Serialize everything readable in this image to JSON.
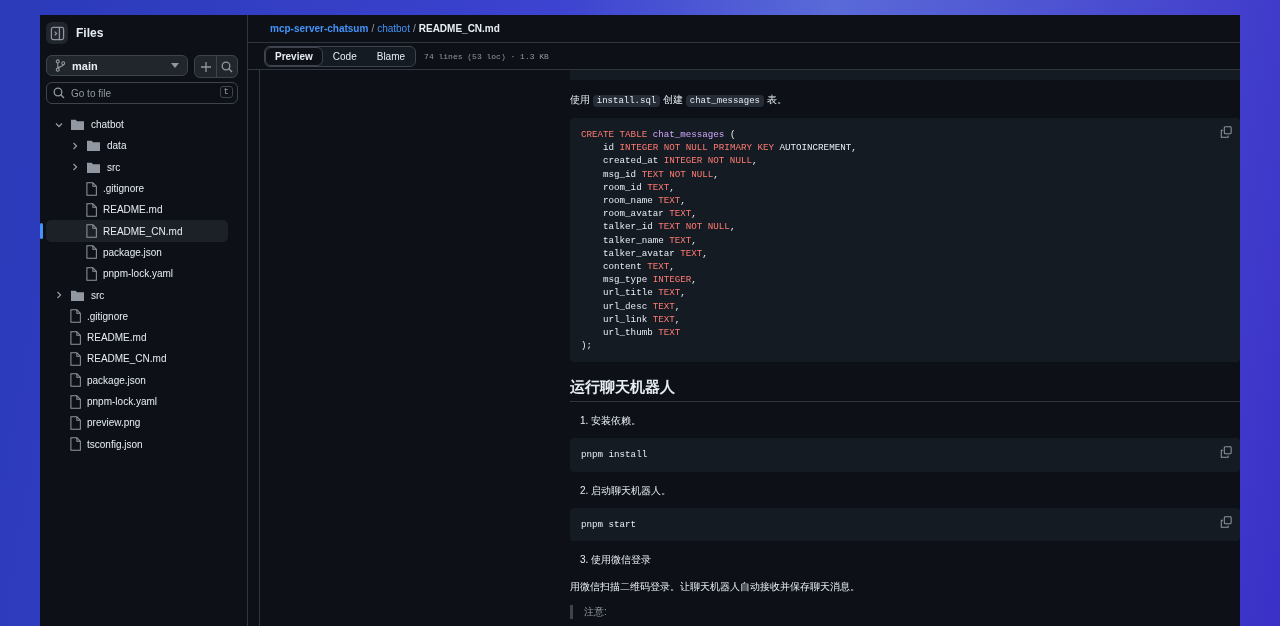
{
  "sidebar": {
    "title": "Files",
    "branch": "main",
    "search": {
      "placeholder": "Go to file",
      "shortcut": "t"
    },
    "tree": [
      {
        "name": "chatbot",
        "kind": "folder",
        "expanded": true,
        "selected": false,
        "children": [
          {
            "name": "data",
            "kind": "folder",
            "expanded": false,
            "selected": false
          },
          {
            "name": "src",
            "kind": "folder",
            "expanded": false,
            "selected": false
          },
          {
            "name": ".gitignore",
            "kind": "file",
            "selected": false
          },
          {
            "name": "README.md",
            "kind": "file",
            "selected": false
          },
          {
            "name": "README_CN.md",
            "kind": "file",
            "selected": true
          },
          {
            "name": "package.json",
            "kind": "file",
            "selected": false
          },
          {
            "name": "pnpm-lock.yaml",
            "kind": "file",
            "selected": false
          }
        ]
      },
      {
        "name": "src",
        "kind": "folder",
        "expanded": false,
        "selected": false
      },
      {
        "name": ".gitignore",
        "kind": "file",
        "selected": false
      },
      {
        "name": "README.md",
        "kind": "file",
        "selected": false
      },
      {
        "name": "README_CN.md",
        "kind": "file",
        "selected": false
      },
      {
        "name": "package.json",
        "kind": "file",
        "selected": false
      },
      {
        "name": "pnpm-lock.yaml",
        "kind": "file",
        "selected": false
      },
      {
        "name": "preview.png",
        "kind": "file",
        "selected": false
      },
      {
        "name": "tsconfig.json",
        "kind": "file",
        "selected": false
      }
    ]
  },
  "breadcrumb_separator": "/",
  "breadcrumb": [
    {
      "text": "mcp-server-chatsum",
      "kind": "link"
    },
    {
      "text": "chatbot",
      "kind": "link"
    },
    {
      "text": "README_CN.md",
      "kind": "current"
    }
  ],
  "tabs": [
    {
      "label": "Preview",
      "selected": true
    },
    {
      "label": "Code",
      "selected": false
    },
    {
      "label": "Blame",
      "selected": false
    }
  ],
  "file_info": "74 lines (53 loc) · 1.3 KB",
  "content": [
    {
      "kind": "code_edge"
    },
    {
      "kind": "paragraph",
      "parts": [
        {
          "text": "使用 ",
          "kind": "text"
        },
        {
          "text": "install.sql",
          "kind": "code"
        },
        {
          "text": " 创建 ",
          "kind": "text"
        },
        {
          "text": "chat_messages",
          "kind": "code"
        },
        {
          "text": " 表。",
          "kind": "text"
        }
      ]
    },
    {
      "kind": "code",
      "lines": [
        [
          {
            "text": "CREATE TABLE ",
            "kind": "keyword"
          },
          {
            "text": "chat_messages",
            "kind": "name"
          },
          {
            "text": " (",
            "kind": "plain"
          }
        ],
        [
          {
            "text": "    id ",
            "kind": "plain"
          },
          {
            "text": "INTEGER NOT NULL PRIMARY KEY",
            "kind": "keyword"
          },
          {
            "text": " AUTOINCREMENT,",
            "kind": "plain"
          }
        ],
        [
          {
            "text": "    created_at ",
            "kind": "plain"
          },
          {
            "text": "INTEGER NOT NULL",
            "kind": "keyword"
          },
          {
            "text": ",",
            "kind": "plain"
          }
        ],
        [
          {
            "text": "    msg_id ",
            "kind": "plain"
          },
          {
            "text": "TEXT NOT NULL",
            "kind": "keyword"
          },
          {
            "text": ",",
            "kind": "plain"
          }
        ],
        [
          {
            "text": "    room_id ",
            "kind": "plain"
          },
          {
            "text": "TEXT",
            "kind": "keyword"
          },
          {
            "text": ",",
            "kind": "plain"
          }
        ],
        [
          {
            "text": "    room_name ",
            "kind": "plain"
          },
          {
            "text": "TEXT",
            "kind": "keyword"
          },
          {
            "text": ",",
            "kind": "plain"
          }
        ],
        [
          {
            "text": "    room_avatar ",
            "kind": "plain"
          },
          {
            "text": "TEXT",
            "kind": "keyword"
          },
          {
            "text": ",",
            "kind": "plain"
          }
        ],
        [
          {
            "text": "    talker_id ",
            "kind": "plain"
          },
          {
            "text": "TEXT NOT NULL",
            "kind": "keyword"
          },
          {
            "text": ",",
            "kind": "plain"
          }
        ],
        [
          {
            "text": "    talker_name ",
            "kind": "plain"
          },
          {
            "text": "TEXT",
            "kind": "keyword"
          },
          {
            "text": ",",
            "kind": "plain"
          }
        ],
        [
          {
            "text": "    talker_avatar ",
            "kind": "plain"
          },
          {
            "text": "TEXT",
            "kind": "keyword"
          },
          {
            "text": ",",
            "kind": "plain"
          }
        ],
        [
          {
            "text": "    content ",
            "kind": "plain"
          },
          {
            "text": "TEXT",
            "kind": "keyword"
          },
          {
            "text": ",",
            "kind": "plain"
          }
        ],
        [
          {
            "text": "    msg_type ",
            "kind": "plain"
          },
          {
            "text": "INTEGER",
            "kind": "keyword"
          },
          {
            "text": ",",
            "kind": "plain"
          }
        ],
        [
          {
            "text": "    url_title ",
            "kind": "plain"
          },
          {
            "text": "TEXT",
            "kind": "keyword"
          },
          {
            "text": ",",
            "kind": "plain"
          }
        ],
        [
          {
            "text": "    url_desc ",
            "kind": "plain"
          },
          {
            "text": "TEXT",
            "kind": "keyword"
          },
          {
            "text": ",",
            "kind": "plain"
          }
        ],
        [
          {
            "text": "    url_link ",
            "kind": "plain"
          },
          {
            "text": "TEXT",
            "kind": "keyword"
          },
          {
            "text": ",",
            "kind": "plain"
          }
        ],
        [
          {
            "text": "    url_thumb ",
            "kind": "plain"
          },
          {
            "text": "TEXT",
            "kind": "keyword"
          }
        ],
        [
          {
            "text": ");",
            "kind": "plain"
          }
        ]
      ]
    },
    {
      "kind": "heading",
      "text": "运行聊天机器人"
    },
    {
      "kind": "list_item",
      "number": "1.",
      "text": "安装依赖。"
    },
    {
      "kind": "code",
      "lines": [
        [
          {
            "text": "pnpm install",
            "kind": "plain"
          }
        ]
      ]
    },
    {
      "kind": "list_item",
      "number": "2.",
      "text": "启动聊天机器人。"
    },
    {
      "kind": "code",
      "lines": [
        [
          {
            "text": "pnpm start",
            "kind": "plain"
          }
        ]
      ]
    },
    {
      "kind": "list_item",
      "number": "3.",
      "text": "使用微信登录"
    },
    {
      "kind": "paragraph",
      "parts": [
        {
          "text": "用微信扫描二维码登录。让聊天机器人自动接收并保存聊天消息。",
          "kind": "text"
        }
      ]
    },
    {
      "kind": "quote",
      "text": "注意:"
    }
  ]
}
